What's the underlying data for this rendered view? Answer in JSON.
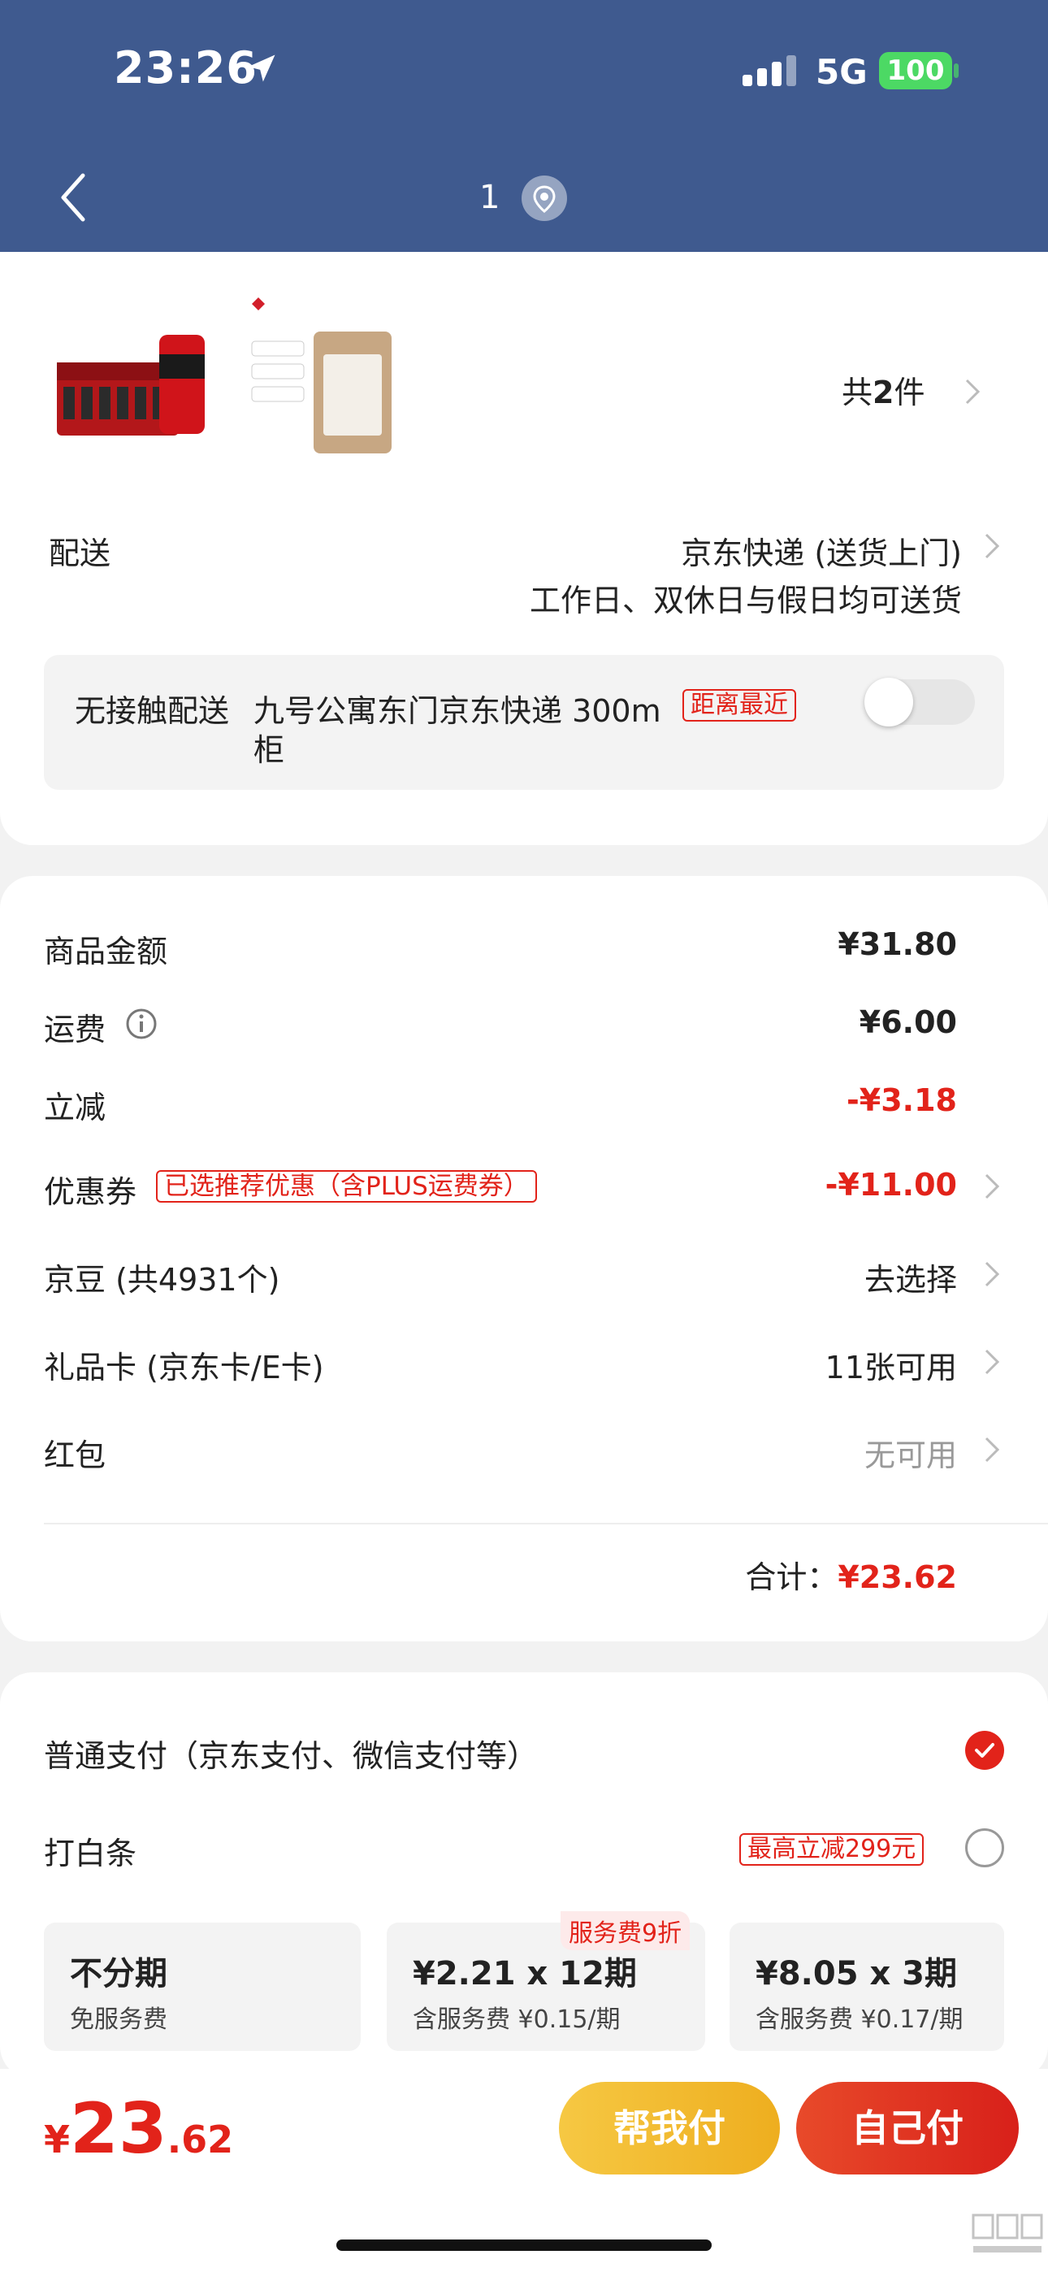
{
  "status": {
    "time": "23:26",
    "network": "5G",
    "battery": "100"
  },
  "nav": {
    "title": "1"
  },
  "products": {
    "count_prefix": "共",
    "count": "2",
    "count_suffix": "件"
  },
  "delivery": {
    "label": "配送",
    "method": "京东快递 (送货上门)",
    "schedule": "工作日、双休日与假日均可送货",
    "contactless_label": "无接触配送",
    "address_line1": "九号公寓东门京东快递 300m",
    "address_line2": "柜",
    "nearest_tag": "距离最近"
  },
  "summary": {
    "items": [
      {
        "label": "商品金额",
        "value": "¥31.80"
      },
      {
        "label": "运费",
        "value": "¥6.00"
      },
      {
        "label": "立减",
        "value": "-¥3.18"
      },
      {
        "label": "优惠券",
        "tag": "已选推荐优惠（含PLUS运费券）",
        "value": "-¥11.00"
      },
      {
        "label": "京豆 (共4931个)",
        "value": "去选择"
      },
      {
        "label": "礼品卡 (京东卡/E卡)",
        "value": "11张可用"
      },
      {
        "label": "红包",
        "value": "无可用"
      }
    ],
    "total_label": "合计：",
    "total_value": "¥23.62"
  },
  "payment": {
    "normal": "普通支付（京东支付、微信支付等）",
    "baitiao": "打白条",
    "baitiao_tag": "最高立减299元",
    "plans": [
      {
        "title": "不分期",
        "sub": "免服务费"
      },
      {
        "title": "¥2.21 x 12期",
        "sub": "含服务费 ¥0.15/期",
        "badge": "服务费9折"
      },
      {
        "title": "¥8.05 x 3期",
        "sub": "含服务费 ¥0.17/期"
      }
    ]
  },
  "bottom": {
    "currency": "¥",
    "price_int": "23",
    "price_dec": ".62",
    "help_pay": "帮我付",
    "self_pay": "自己付"
  },
  "watermark": "值值值 zhizhizhi.com",
  "colors": {
    "header": "#3f5a8f",
    "accent_red": "#e2231a",
    "help_btn": "#f5c12e"
  }
}
